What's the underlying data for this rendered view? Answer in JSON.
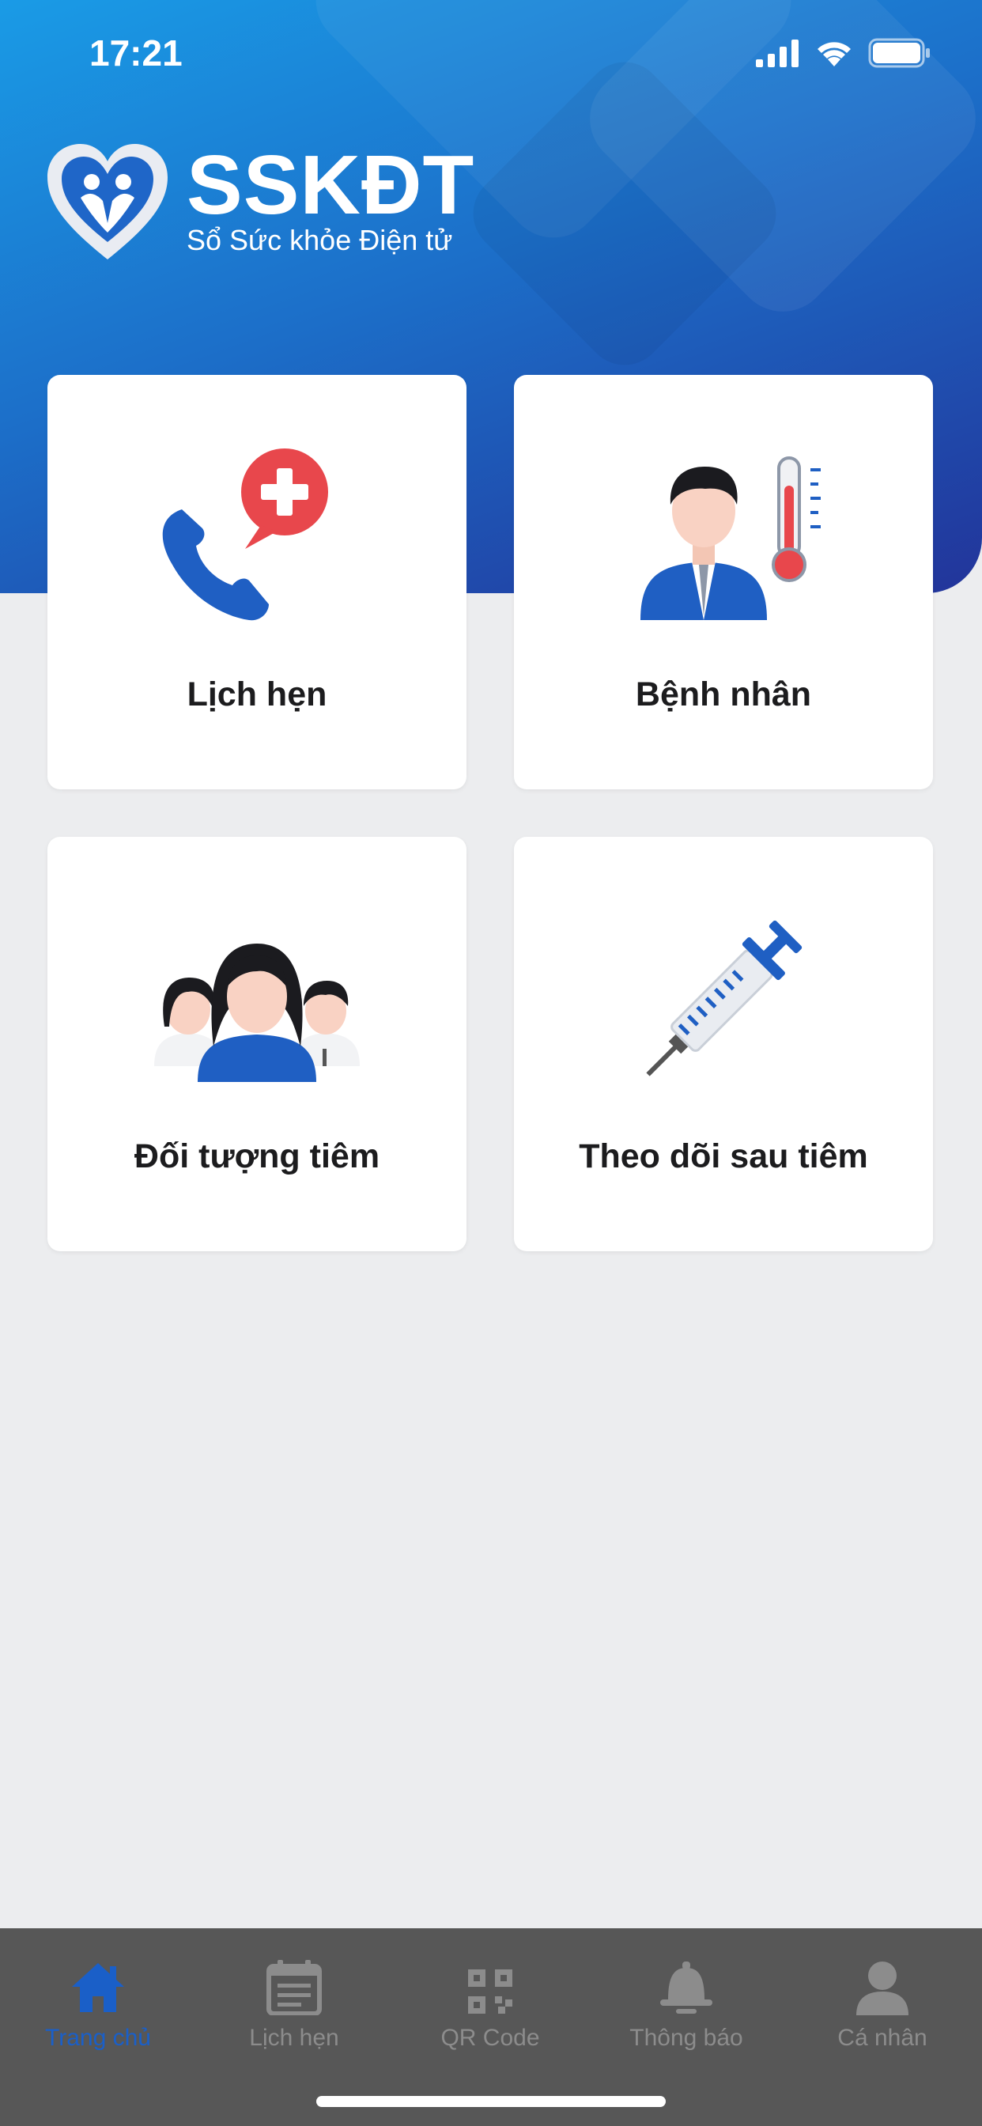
{
  "status_bar": {
    "time": "17:21"
  },
  "logo": {
    "title": "SSKĐT",
    "subtitle": "Sổ Sức khỏe Điện tử"
  },
  "menu": {
    "appointments": "Lịch hẹn",
    "patients": "Bệnh nhân",
    "vaccination_subjects": "Đối tượng tiêm",
    "post_vaccination": "Theo dõi sau tiêm"
  },
  "tabs": {
    "home": "Trang chủ",
    "schedule": "Lịch hẹn",
    "qr": "QR Code",
    "notifications": "Thông báo",
    "profile": "Cá nhân"
  },
  "colors": {
    "brand_start": "#1a9be6",
    "brand_end": "#22349a",
    "active_tab": "#1a5fc8",
    "tab_inactive": "#8c8c8c"
  }
}
